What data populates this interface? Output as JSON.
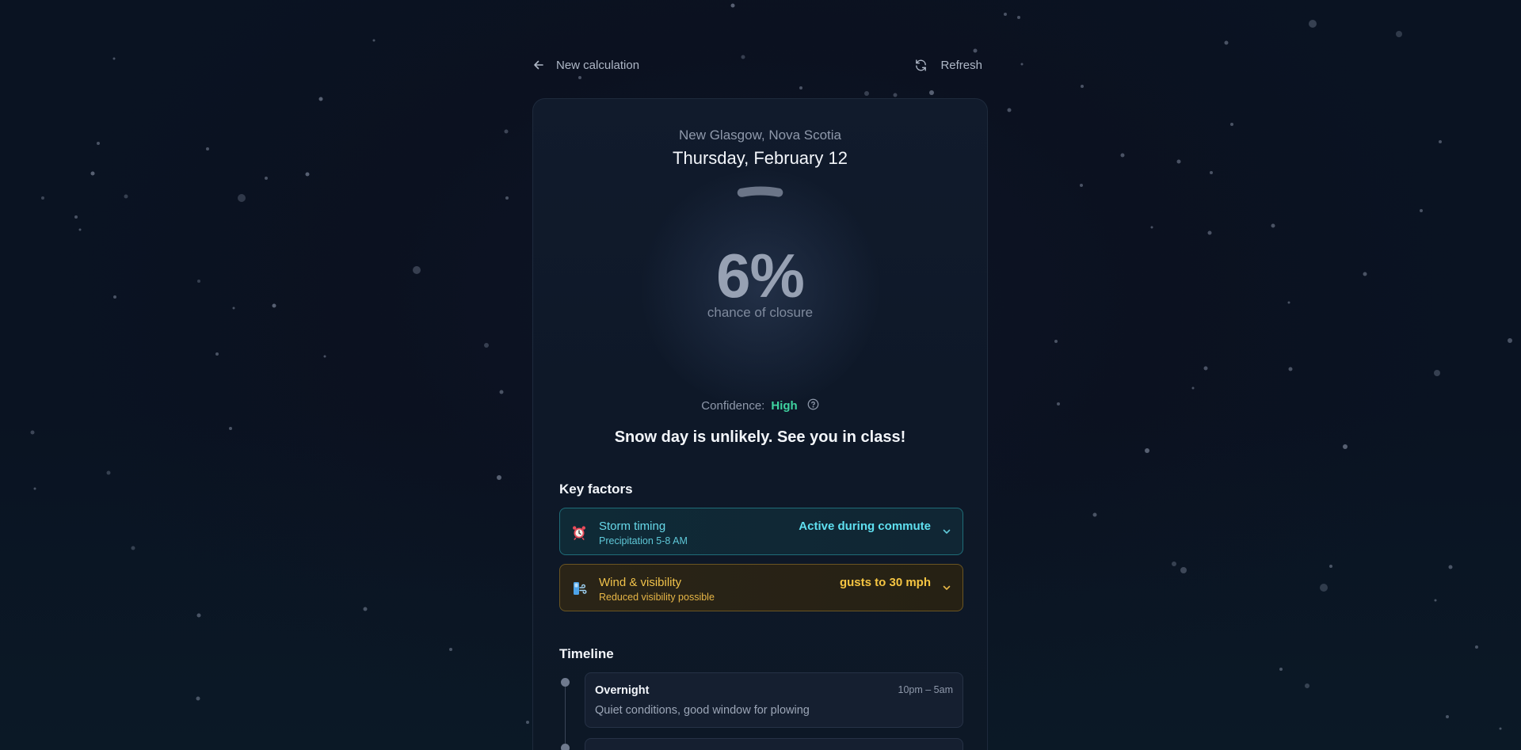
{
  "nav": {
    "back_label": "New calculation",
    "refresh_label": "Refresh"
  },
  "forecast": {
    "location": "New Glasgow, Nova Scotia",
    "date": "Thursday, February 12",
    "percent_text": "6%",
    "percent_value": 6,
    "percent_caption": "chance of closure",
    "confidence_label": "Confidence:",
    "confidence_level": "High",
    "verdict": "Snow day is unlikely. See you in class!"
  },
  "key_factors": {
    "title": "Key factors",
    "items": [
      {
        "icon": "alarm-clock-icon",
        "title": "Storm timing",
        "subtitle": "Precipitation 5-8 AM",
        "value": "Active during commute",
        "color": "#5fe0f0"
      },
      {
        "icon": "wind-icon",
        "title": "Wind & visibility",
        "subtitle": "Reduced visibility possible",
        "value": "gusts to 30 mph",
        "color": "#f5c542"
      }
    ]
  },
  "timeline": {
    "title": "Timeline",
    "items": [
      {
        "title": "Overnight",
        "time": "10pm – 5am",
        "description": "Quiet conditions, good window for plowing"
      }
    ]
  },
  "colors": {
    "confidence_high": "#3fd3a0",
    "factor_cyan": "#5fe0f0",
    "factor_amber": "#f5c542"
  }
}
